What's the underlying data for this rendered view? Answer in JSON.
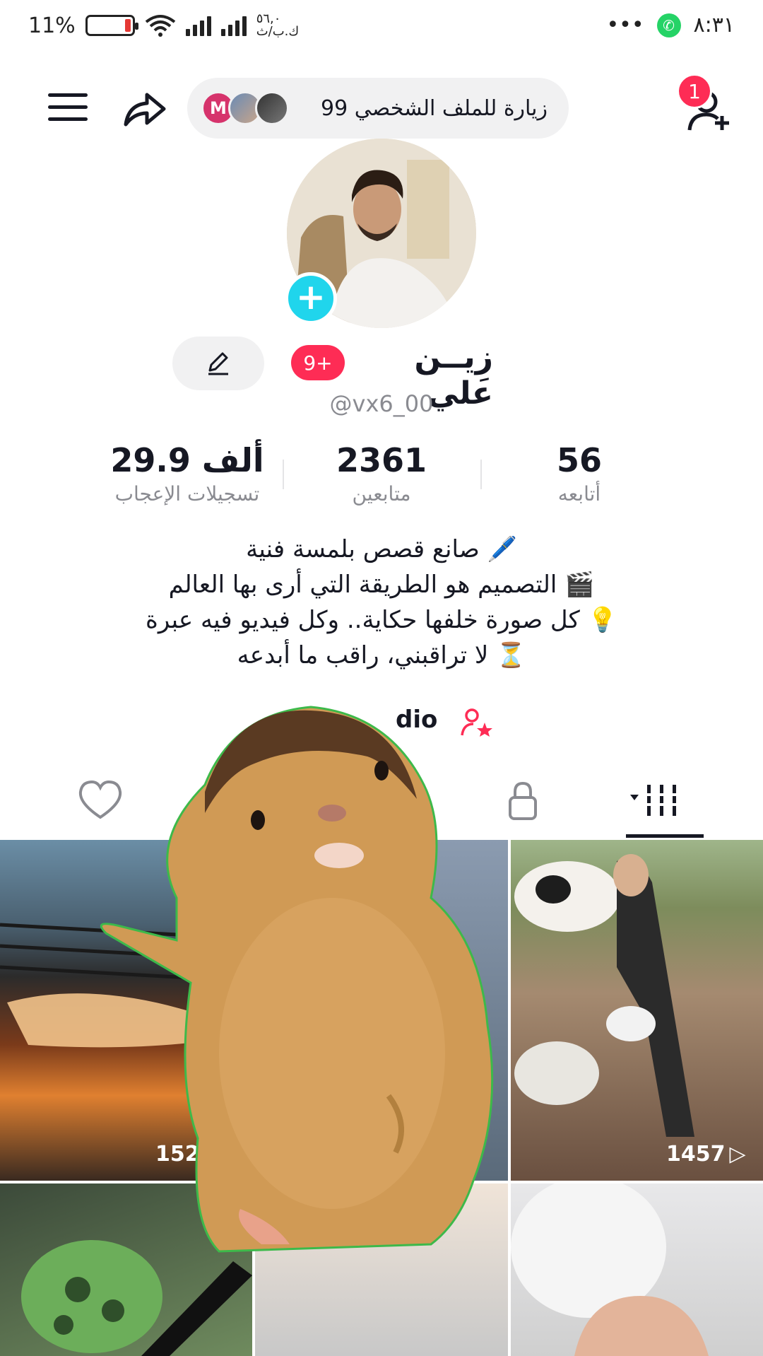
{
  "status_bar": {
    "time": "٨:٣١",
    "dots": "•••",
    "battery": "11%",
    "speed_value": "٥٦,٠",
    "speed_unit": "ك.ب/ث"
  },
  "header": {
    "visits_text": "99 زيارة للملف الشخصي",
    "visitor_initial": "M",
    "notification_count": "1"
  },
  "profile": {
    "name": "زِيــن علي",
    "badge": "9+",
    "handle": "@vx6_00"
  },
  "stats": {
    "following": {
      "value": "56",
      "label": "أتابعه"
    },
    "followers": {
      "value": "2361",
      "label": "متابعين"
    },
    "likes": {
      "value": "29.9 ألف",
      "label": "تسجيلات الإعجاب"
    }
  },
  "bio": {
    "line1": "🖊️ صانع قصص بلمسة فنية",
    "line2": "🎬 التصميم هو الطريقة التي أرى بها العالم",
    "line3": "💡 كل صورة خلفها حكاية.. وكل فيديو فيه عبرة",
    "line4": "⏳ لا تراقبني، راقب ما أبدعه"
  },
  "studio": {
    "label": "dio"
  },
  "tabs": [
    "videos-grid-icon",
    "lock-icon",
    "bookmark-icon",
    "heart-icon"
  ],
  "videos": [
    {
      "views": "1522"
    },
    {
      "views": ""
    },
    {
      "views": "1457"
    }
  ],
  "colors": {
    "accent": "#fe2c55",
    "cyan": "#20d5ec",
    "pill_bg": "#f1f1f2"
  }
}
